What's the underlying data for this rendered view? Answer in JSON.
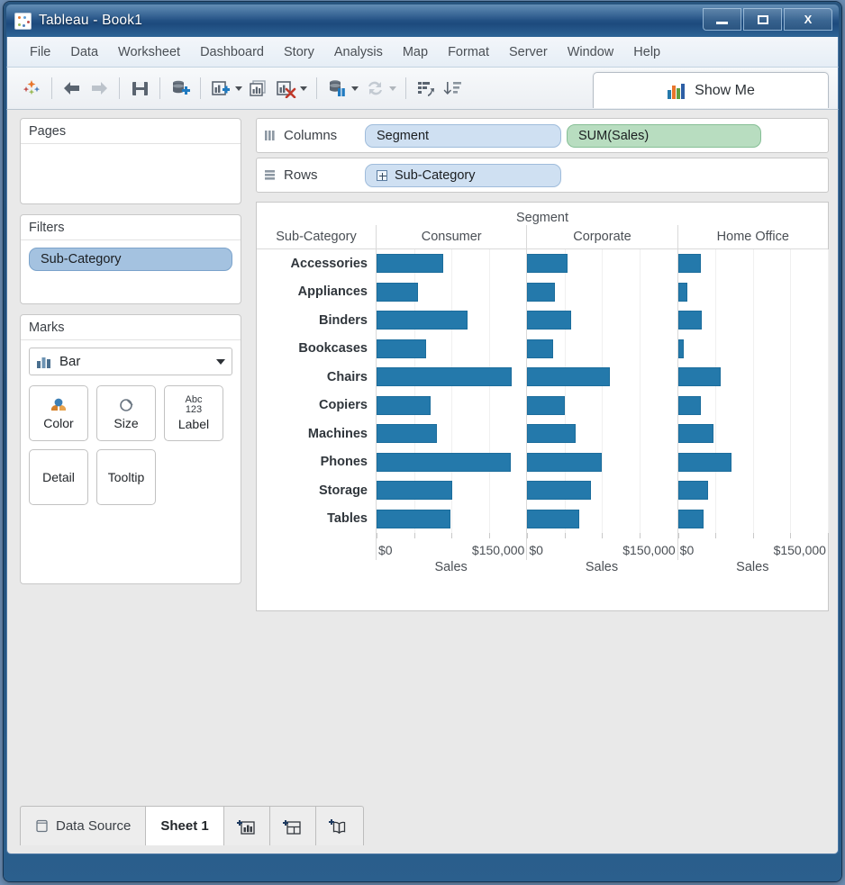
{
  "window": {
    "title": "Tableau - Book1",
    "app_icon": "tableau-logo-icon",
    "buttons": {
      "minimize": "minimize-icon",
      "maximize": "maximize-icon",
      "close": "X"
    }
  },
  "menu": {
    "items": [
      "File",
      "Data",
      "Worksheet",
      "Dashboard",
      "Story",
      "Analysis",
      "Map",
      "Format",
      "Server",
      "Window",
      "Help"
    ]
  },
  "toolbar": {
    "icons": [
      "tableau-sparkle-icon",
      "back-arrow-icon",
      "forward-arrow-icon",
      "save-icon",
      "new-data-source-icon",
      "new-worksheet-icon",
      "duplicate-sheet-icon",
      "clear-sheet-icon",
      "pause-updates-icon",
      "refresh-data-icon",
      "sort-ascending-icon",
      "sort-descending-icon"
    ],
    "show_me_label": "Show Me",
    "show_me_icon": "show-me-bars-icon"
  },
  "panels": {
    "pages": {
      "title": "Pages",
      "fields": []
    },
    "filters": {
      "title": "Filters",
      "fields": [
        "Sub-Category"
      ]
    },
    "marks": {
      "title": "Marks",
      "mark_type": "Bar",
      "mark_type_icon": "bar-mark-icon",
      "cards": [
        {
          "label": "Color",
          "icon": "color-palette-icon"
        },
        {
          "label": "Size",
          "icon": "size-icon"
        },
        {
          "label": "Label",
          "icon": "abc-123-icon"
        },
        {
          "label": "Detail",
          "icon": "detail-icon"
        },
        {
          "label": "Tooltip",
          "icon": "tooltip-icon"
        }
      ]
    }
  },
  "shelves": {
    "columns": {
      "label": "Columns",
      "icon": "columns-icon",
      "pills": [
        {
          "text": "Segment",
          "type": "dimension"
        },
        {
          "text": "SUM(Sales)",
          "type": "measure"
        }
      ]
    },
    "rows": {
      "label": "Rows",
      "icon": "rows-icon",
      "pills": [
        {
          "text": "Sub-Category",
          "type": "dimension",
          "expand_icon": "plus-box-icon"
        }
      ]
    }
  },
  "chart_data": {
    "type": "bar",
    "title": "Segment",
    "row_header": "Sub-Category",
    "xlabel": "Sales",
    "ylabel": "Sub-Category",
    "grid": true,
    "legend": "none",
    "xlim": [
      0,
      200000
    ],
    "xticks": [
      0,
      50000,
      100000,
      150000,
      200000
    ],
    "xtick_labels": [
      "$0",
      "",
      "",
      "$150,000",
      ""
    ],
    "axis_label_left": "$0",
    "axis_label_right": "$150,000",
    "axis_caption": "Sales",
    "categories": [
      "Accessories",
      "Appliances",
      "Binders",
      "Bookcases",
      "Chairs",
      "Copiers",
      "Machines",
      "Phones",
      "Storage",
      "Tables"
    ],
    "panes": [
      "Consumer",
      "Corporate",
      "Home Office"
    ],
    "series": [
      {
        "name": "Consumer",
        "values": [
          89000,
          55000,
          122000,
          66000,
          180000,
          72000,
          80000,
          179000,
          101000,
          98000
        ]
      },
      {
        "name": "Corporate",
        "values": [
          54000,
          37000,
          58000,
          35000,
          110000,
          50000,
          65000,
          100000,
          85000,
          69000
        ]
      },
      {
        "name": "Home Office",
        "values": [
          31000,
          13000,
          32000,
          8000,
          57000,
          30000,
          47000,
          71000,
          40000,
          34000
        ]
      }
    ]
  },
  "status_bar": {
    "data_source_label": "Data Source",
    "data_source_icon": "database-icon",
    "sheet_tab": "Sheet 1",
    "new_worksheet_icon": "new-worksheet-tab-icon",
    "new_dashboard_icon": "new-dashboard-tab-icon",
    "new_story_icon": "new-story-tab-icon"
  },
  "colors": {
    "bar": "#2479ab",
    "bar_border": "#1c6d9c",
    "dimension_pill": "#a4c2e0",
    "measure_pill": "#b8ddc0",
    "title_bar": "#28557f"
  }
}
